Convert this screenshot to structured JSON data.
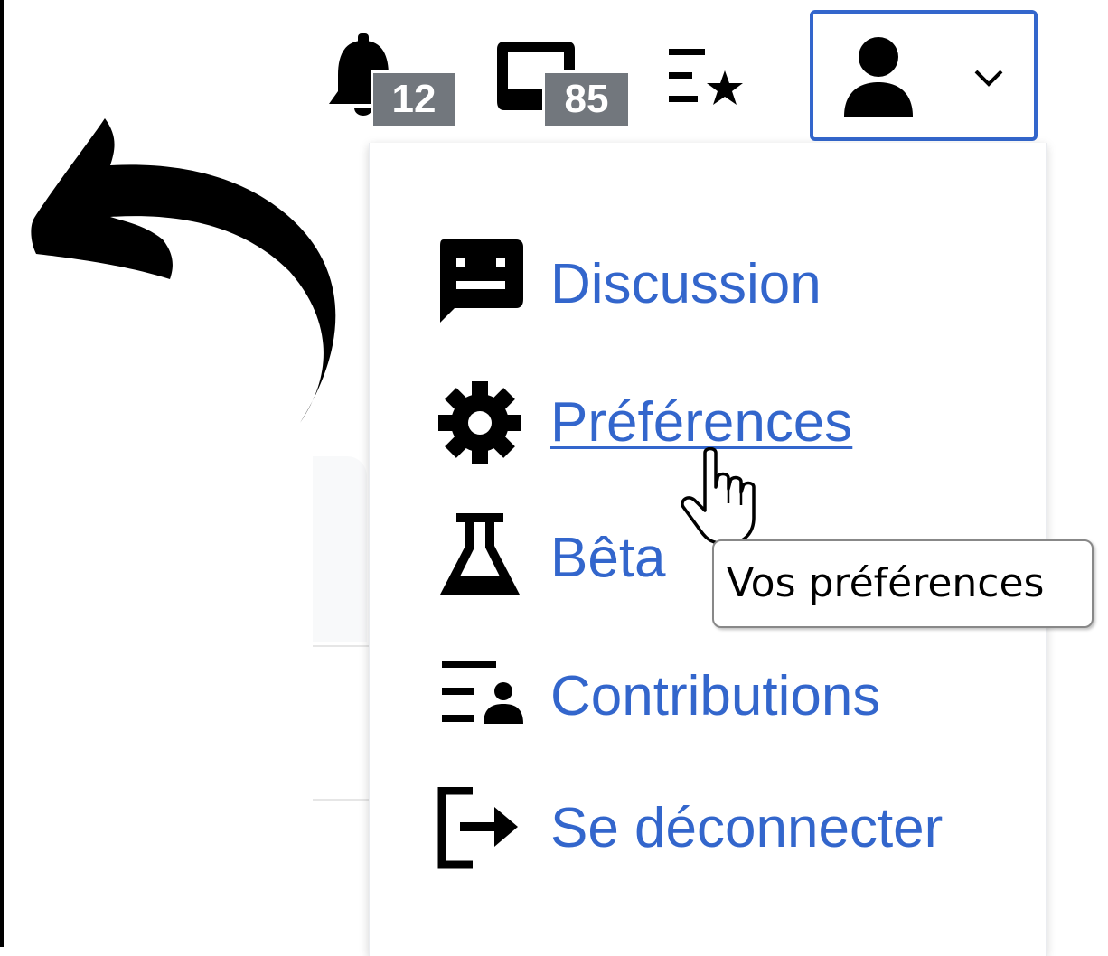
{
  "toolbar": {
    "notifications": {
      "icon": "bell-icon",
      "count": "12"
    },
    "messages": {
      "icon": "inbox-icon",
      "count": "85"
    },
    "watchlist": {
      "icon": "watchlist-icon"
    },
    "user_menu": {
      "icon": "user-avatar-icon",
      "chevron": "chevron-down-icon",
      "border_color": "#3366cc"
    }
  },
  "menu": {
    "items": [
      {
        "icon": "talk-icon",
        "label": "Discussion"
      },
      {
        "icon": "gear-icon",
        "label": "Préférences"
      },
      {
        "icon": "flask-icon",
        "label": "Bêta"
      },
      {
        "icon": "contributions-icon",
        "label": "Contributions"
      },
      {
        "icon": "logout-icon",
        "label": "Se déconnecter"
      }
    ],
    "link_color": "#3366cc"
  },
  "tooltip": {
    "text": "Vos préférences"
  },
  "annotation": {
    "icon": "curved-arrow-icon"
  },
  "badge_color": "#72777d"
}
